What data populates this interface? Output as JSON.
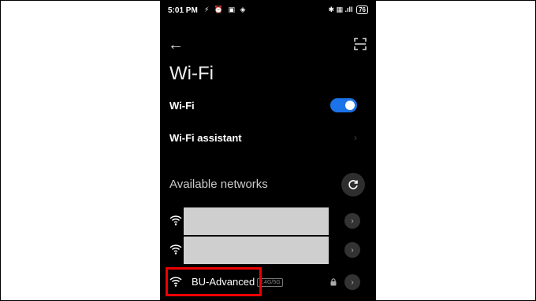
{
  "status_bar": {
    "time": "5:01 PM",
    "left_icons": "⚡ ⏰ ▣ ◈",
    "right_icons": "✱ ▦ .ıll",
    "battery": "76"
  },
  "page_title": "Wi-Fi",
  "settings": {
    "wifi_label": "Wi-Fi",
    "wifi_enabled": true,
    "assistant_label": "Wi-Fi assistant",
    "chevron": "›"
  },
  "networks": {
    "section_label": "Available networks",
    "items": [
      {
        "name": "",
        "redacted": true
      },
      {
        "name": "",
        "redacted": true
      },
      {
        "name": "BU-Advanced",
        "band": "2.4G/5G",
        "locked": true
      }
    ],
    "go_glyph": "›"
  },
  "colors": {
    "accent": "#1a73e8",
    "highlight": "#e00000"
  }
}
